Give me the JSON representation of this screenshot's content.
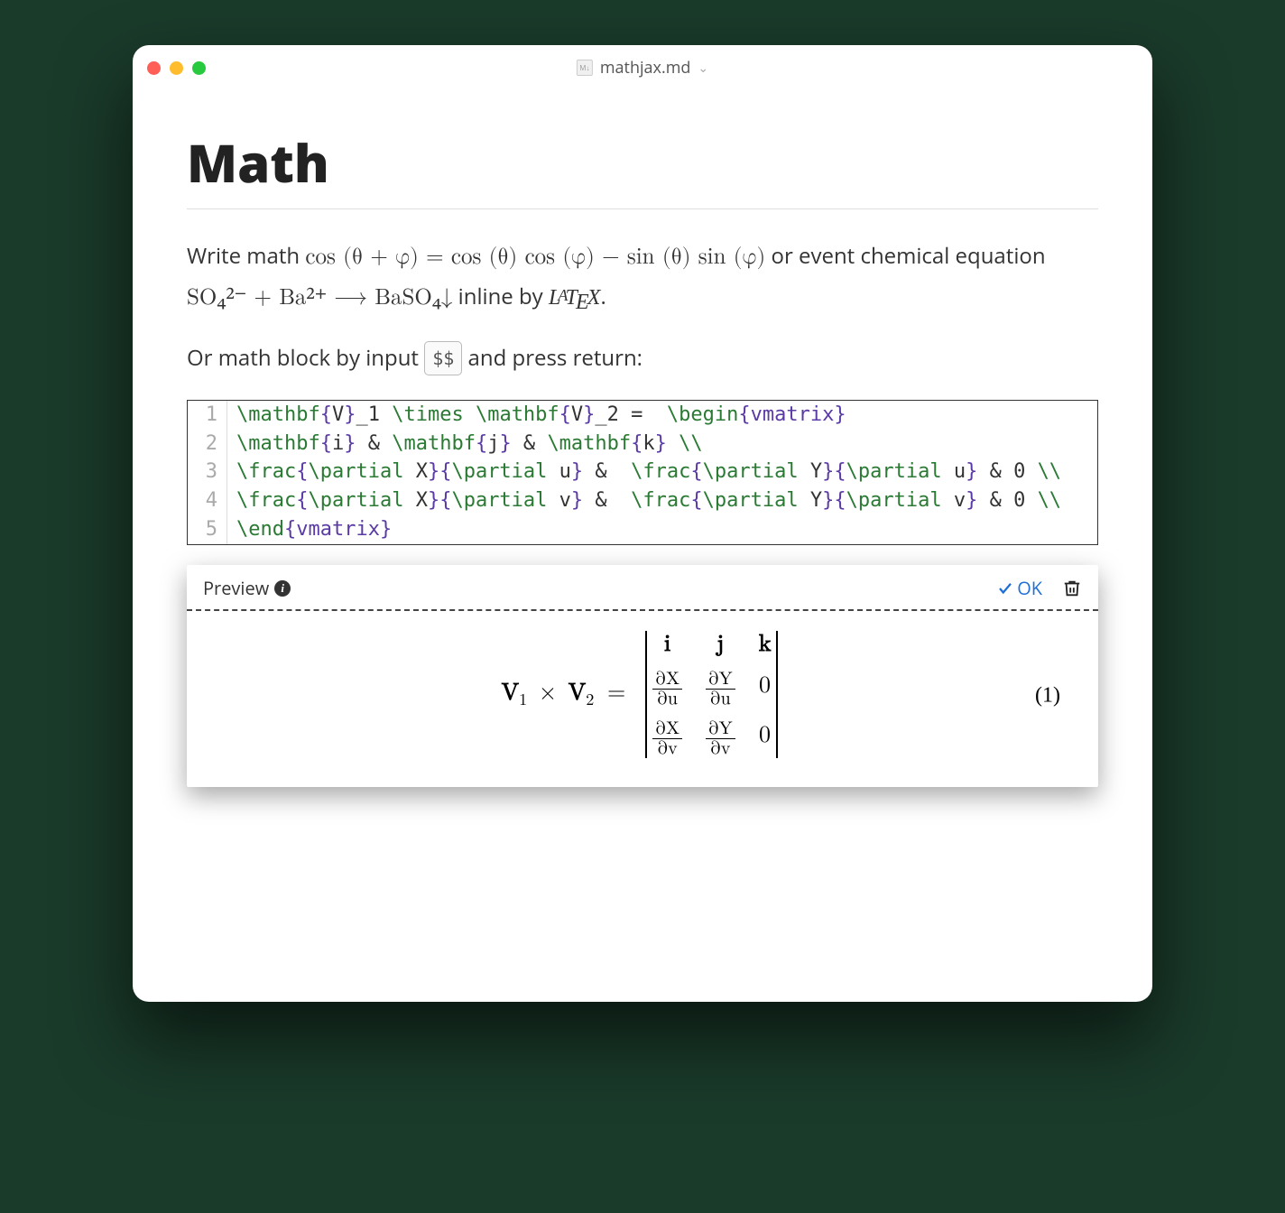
{
  "titlebar": {
    "filename": "mathjax.md",
    "filebadge": "M↓"
  },
  "heading": "Math",
  "para1": {
    "t1": "Write math ",
    "math1": "cos (θ + φ) = cos (θ) cos (φ) − sin (θ) sin (φ)",
    "t2": "  or event chemical equation ",
    "math2": "SO₄²⁻ + Ba²⁺ ⟶ BaSO₄↓",
    "t3": "  inline by ",
    "latex": "LᴬTᴇX",
    "t4": "."
  },
  "para2": {
    "t1": "Or math block by input ",
    "kbd": "$$",
    "t2": " and press return:"
  },
  "code": {
    "lines": [
      {
        "n": "1",
        "tokens": [
          [
            "cmd",
            "\\mathbf"
          ],
          [
            "brace",
            "{"
          ],
          [
            "arg",
            "V"
          ],
          [
            "brace",
            "}"
          ],
          [
            "arg",
            "_1 "
          ],
          [
            "cmd",
            "\\times"
          ],
          [
            "arg",
            " "
          ],
          [
            "cmd",
            "\\mathbf"
          ],
          [
            "brace",
            "{"
          ],
          [
            "arg",
            "V"
          ],
          [
            "brace",
            "}"
          ],
          [
            "arg",
            "_2 =  "
          ],
          [
            "cmd",
            "\\begin"
          ],
          [
            "brace",
            "{"
          ],
          [
            "brace",
            "vmatrix"
          ],
          [
            "brace",
            "}"
          ]
        ]
      },
      {
        "n": "2",
        "tokens": [
          [
            "cmd",
            "\\mathbf"
          ],
          [
            "brace",
            "{"
          ],
          [
            "arg",
            "i"
          ],
          [
            "brace",
            "}"
          ],
          [
            "arg",
            " & "
          ],
          [
            "cmd",
            "\\mathbf"
          ],
          [
            "brace",
            "{"
          ],
          [
            "arg",
            "j"
          ],
          [
            "brace",
            "}"
          ],
          [
            "arg",
            " & "
          ],
          [
            "cmd",
            "\\mathbf"
          ],
          [
            "brace",
            "{"
          ],
          [
            "arg",
            "k"
          ],
          [
            "brace",
            "}"
          ],
          [
            "arg",
            " "
          ],
          [
            "op",
            "\\\\"
          ]
        ]
      },
      {
        "n": "3",
        "tokens": [
          [
            "cmd",
            "\\frac"
          ],
          [
            "brace",
            "{"
          ],
          [
            "cmd",
            "\\partial"
          ],
          [
            "arg",
            " X"
          ],
          [
            "brace",
            "}{"
          ],
          [
            "cmd",
            "\\partial"
          ],
          [
            "arg",
            " u"
          ],
          [
            "brace",
            "}"
          ],
          [
            "arg",
            " &  "
          ],
          [
            "cmd",
            "\\frac"
          ],
          [
            "brace",
            "{"
          ],
          [
            "cmd",
            "\\partial"
          ],
          [
            "arg",
            " Y"
          ],
          [
            "brace",
            "}{"
          ],
          [
            "cmd",
            "\\partial"
          ],
          [
            "arg",
            " u"
          ],
          [
            "brace",
            "}"
          ],
          [
            "arg",
            " & 0 "
          ],
          [
            "op",
            "\\\\"
          ]
        ]
      },
      {
        "n": "4",
        "tokens": [
          [
            "cmd",
            "\\frac"
          ],
          [
            "brace",
            "{"
          ],
          [
            "cmd",
            "\\partial"
          ],
          [
            "arg",
            " X"
          ],
          [
            "brace",
            "}{"
          ],
          [
            "cmd",
            "\\partial"
          ],
          [
            "arg",
            " v"
          ],
          [
            "brace",
            "}"
          ],
          [
            "arg",
            " &  "
          ],
          [
            "cmd",
            "\\frac"
          ],
          [
            "brace",
            "{"
          ],
          [
            "cmd",
            "\\partial"
          ],
          [
            "arg",
            " Y"
          ],
          [
            "brace",
            "}{"
          ],
          [
            "cmd",
            "\\partial"
          ],
          [
            "arg",
            " v"
          ],
          [
            "brace",
            "}"
          ],
          [
            "arg",
            " & 0 "
          ],
          [
            "op",
            "\\\\"
          ]
        ]
      },
      {
        "n": "5",
        "tokens": [
          [
            "cmd",
            "\\end"
          ],
          [
            "brace",
            "{"
          ],
          [
            "brace",
            "vmatrix"
          ],
          [
            "brace",
            "}"
          ]
        ]
      }
    ]
  },
  "preview": {
    "label": "Preview",
    "ok": "OK",
    "eqno": "(1)",
    "lhs": {
      "V": "V",
      "one": "1",
      "times": "×",
      "two": "2",
      "eq": "="
    },
    "matrix": {
      "headers": [
        "i",
        "j",
        "k"
      ],
      "rows": [
        [
          {
            "num": "∂X",
            "den": "∂u"
          },
          {
            "num": "∂Y",
            "den": "∂u"
          },
          "0"
        ],
        [
          {
            "num": "∂X",
            "den": "∂v"
          },
          {
            "num": "∂Y",
            "den": "∂v"
          },
          "0"
        ]
      ]
    }
  }
}
